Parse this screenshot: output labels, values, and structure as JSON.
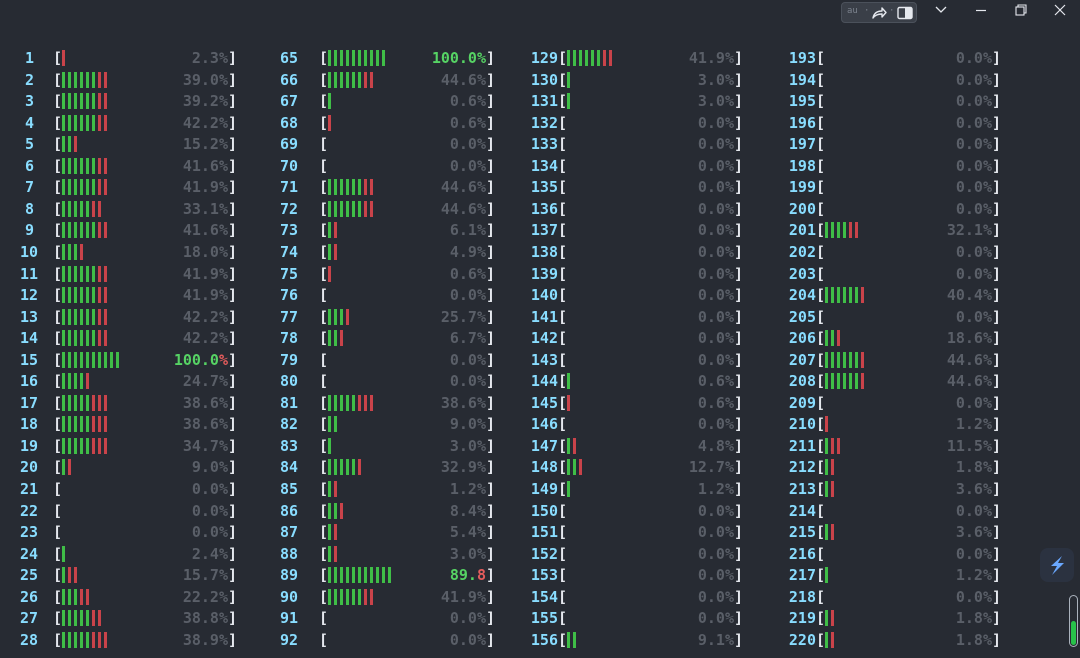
{
  "titlebar": {
    "mini_label": "au",
    "icons": [
      "chevron-down-icon",
      "minimize-icon",
      "restore-icon",
      "close-icon",
      "share-icon",
      "split-view-icon"
    ]
  },
  "columns": [
    [
      {
        "n": "1",
        "g": 0,
        "r": 1,
        "p": "2.3%"
      },
      {
        "n": "2",
        "g": 6,
        "r": 2,
        "p": "39.0%"
      },
      {
        "n": "3",
        "g": 6,
        "r": 2,
        "p": "39.2%"
      },
      {
        "n": "4",
        "g": 6,
        "r": 2,
        "p": "42.2%"
      },
      {
        "n": "5",
        "g": 2,
        "r": 1,
        "p": "15.2%"
      },
      {
        "n": "6",
        "g": 6,
        "r": 2,
        "p": "41.6%"
      },
      {
        "n": "7",
        "g": 6,
        "r": 2,
        "p": "41.9%"
      },
      {
        "n": "8",
        "g": 5,
        "r": 2,
        "p": "33.1%"
      },
      {
        "n": "9",
        "g": 6,
        "r": 2,
        "p": "41.6%"
      },
      {
        "n": "10",
        "g": 3,
        "r": 1,
        "p": "18.0%"
      },
      {
        "n": "11",
        "g": 6,
        "r": 2,
        "p": "41.9%"
      },
      {
        "n": "12",
        "g": 6,
        "r": 2,
        "p": "41.9%"
      },
      {
        "n": "13",
        "g": 6,
        "r": 2,
        "p": "42.2%"
      },
      {
        "n": "14",
        "g": 6,
        "r": 2,
        "p": "42.2%"
      },
      {
        "n": "15",
        "g": 10,
        "r": 0,
        "p": "100.0",
        "p2": "%",
        "hot": true
      },
      {
        "n": "16",
        "g": 4,
        "r": 1,
        "p": "24.7%"
      },
      {
        "n": "17",
        "g": 5,
        "r": 3,
        "p": "38.6%"
      },
      {
        "n": "18",
        "g": 5,
        "r": 3,
        "p": "38.6%"
      },
      {
        "n": "19",
        "g": 5,
        "r": 3,
        "p": "34.7%"
      },
      {
        "n": "20",
        "g": 1,
        "r": 1,
        "p": "9.0%"
      },
      {
        "n": "21",
        "g": 0,
        "r": 0,
        "p": "0.0%"
      },
      {
        "n": "22",
        "g": 0,
        "r": 0,
        "p": "0.0%"
      },
      {
        "n": "23",
        "g": 0,
        "r": 0,
        "p": "0.0%"
      },
      {
        "n": "24",
        "g": 1,
        "r": 0,
        "p": "2.4%"
      },
      {
        "n": "25",
        "g": 1,
        "r": 2,
        "p": "15.7%"
      },
      {
        "n": "26",
        "g": 3,
        "r": 2,
        "p": "22.2%"
      },
      {
        "n": "27",
        "g": 5,
        "r": 2,
        "p": "38.8%"
      },
      {
        "n": "28",
        "g": 5,
        "r": 3,
        "p": "38.9%"
      }
    ],
    [
      {
        "n": "65",
        "g": 10,
        "r": 0,
        "p": "100.0%",
        "hot": true
      },
      {
        "n": "66",
        "g": 6,
        "r": 2,
        "p": "44.6%"
      },
      {
        "n": "67",
        "g": 1,
        "r": 0,
        "p": "0.6%"
      },
      {
        "n": "68",
        "g": 0,
        "r": 1,
        "p": "0.6%"
      },
      {
        "n": "69",
        "g": 0,
        "r": 0,
        "p": "0.0%"
      },
      {
        "n": "70",
        "g": 0,
        "r": 0,
        "p": "0.0%"
      },
      {
        "n": "71",
        "g": 6,
        "r": 2,
        "p": "44.6%"
      },
      {
        "n": "72",
        "g": 6,
        "r": 2,
        "p": "44.6%"
      },
      {
        "n": "73",
        "g": 1,
        "r": 1,
        "p": "6.1%"
      },
      {
        "n": "74",
        "g": 1,
        "r": 1,
        "p": "4.9%"
      },
      {
        "n": "75",
        "g": 0,
        "r": 1,
        "p": "0.6%"
      },
      {
        "n": "76",
        "g": 0,
        "r": 0,
        "p": "0.0%"
      },
      {
        "n": "77",
        "g": 3,
        "r": 1,
        "p": "25.7%"
      },
      {
        "n": "78",
        "g": 2,
        "r": 1,
        "p": "6.7%"
      },
      {
        "n": "79",
        "g": 0,
        "r": 0,
        "p": "0.0%"
      },
      {
        "n": "80",
        "g": 0,
        "r": 0,
        "p": "0.0%"
      },
      {
        "n": "81",
        "g": 5,
        "r": 3,
        "p": "38.6%"
      },
      {
        "n": "82",
        "g": 2,
        "r": 0,
        "p": "9.0%"
      },
      {
        "n": "83",
        "g": 1,
        "r": 0,
        "p": "3.0%"
      },
      {
        "n": "84",
        "g": 5,
        "r": 1,
        "p": "32.9%"
      },
      {
        "n": "85",
        "g": 1,
        "r": 1,
        "p": "1.2%"
      },
      {
        "n": "86",
        "g": 2,
        "r": 1,
        "p": "8.4%"
      },
      {
        "n": "87",
        "g": 1,
        "r": 1,
        "p": "5.4%"
      },
      {
        "n": "88",
        "g": 1,
        "r": 1,
        "p": "3.0%"
      },
      {
        "n": "89",
        "g": 11,
        "r": 0,
        "p": "89.",
        "p2": "8",
        "hot": true
      },
      {
        "n": "90",
        "g": 6,
        "r": 2,
        "p": "41.9%"
      },
      {
        "n": "91",
        "g": 0,
        "r": 0,
        "p": "0.0%"
      },
      {
        "n": "92",
        "g": 0,
        "r": 0,
        "p": "0.0%"
      }
    ],
    [
      {
        "n": "129",
        "g": 6,
        "r": 2,
        "p": "41.9%"
      },
      {
        "n": "130",
        "g": 1,
        "r": 0,
        "p": "3.0%"
      },
      {
        "n": "131",
        "g": 1,
        "r": 0,
        "p": "3.0%"
      },
      {
        "n": "132",
        "g": 0,
        "r": 0,
        "p": "0.0%"
      },
      {
        "n": "133",
        "g": 0,
        "r": 0,
        "p": "0.0%"
      },
      {
        "n": "134",
        "g": 0,
        "r": 0,
        "p": "0.0%"
      },
      {
        "n": "135",
        "g": 0,
        "r": 0,
        "p": "0.0%"
      },
      {
        "n": "136",
        "g": 0,
        "r": 0,
        "p": "0.0%"
      },
      {
        "n": "137",
        "g": 0,
        "r": 0,
        "p": "0.0%"
      },
      {
        "n": "138",
        "g": 0,
        "r": 0,
        "p": "0.0%"
      },
      {
        "n": "139",
        "g": 0,
        "r": 0,
        "p": "0.0%"
      },
      {
        "n": "140",
        "g": 0,
        "r": 0,
        "p": "0.0%"
      },
      {
        "n": "141",
        "g": 0,
        "r": 0,
        "p": "0.0%"
      },
      {
        "n": "142",
        "g": 0,
        "r": 0,
        "p": "0.0%"
      },
      {
        "n": "143",
        "g": 0,
        "r": 0,
        "p": "0.0%"
      },
      {
        "n": "144",
        "g": 1,
        "r": 0,
        "p": "0.6%"
      },
      {
        "n": "145",
        "g": 0,
        "r": 1,
        "p": "0.6%"
      },
      {
        "n": "146",
        "g": 0,
        "r": 0,
        "p": "0.0%"
      },
      {
        "n": "147",
        "g": 1,
        "r": 1,
        "p": "4.8%"
      },
      {
        "n": "148",
        "g": 2,
        "r": 1,
        "p": "12.7%"
      },
      {
        "n": "149",
        "g": 1,
        "r": 0,
        "p": "1.2%"
      },
      {
        "n": "150",
        "g": 0,
        "r": 0,
        "p": "0.0%"
      },
      {
        "n": "151",
        "g": 0,
        "r": 0,
        "p": "0.0%"
      },
      {
        "n": "152",
        "g": 0,
        "r": 0,
        "p": "0.0%"
      },
      {
        "n": "153",
        "g": 0,
        "r": 0,
        "p": "0.0%"
      },
      {
        "n": "154",
        "g": 0,
        "r": 0,
        "p": "0.0%"
      },
      {
        "n": "155",
        "g": 0,
        "r": 0,
        "p": "0.0%"
      },
      {
        "n": "156",
        "g": 2,
        "r": 0,
        "p": "9.1%"
      }
    ],
    [
      {
        "n": "193",
        "g": 0,
        "r": 0,
        "p": "0.0%"
      },
      {
        "n": "194",
        "g": 0,
        "r": 0,
        "p": "0.0%"
      },
      {
        "n": "195",
        "g": 0,
        "r": 0,
        "p": "0.0%"
      },
      {
        "n": "196",
        "g": 0,
        "r": 0,
        "p": "0.0%"
      },
      {
        "n": "197",
        "g": 0,
        "r": 0,
        "p": "0.0%"
      },
      {
        "n": "198",
        "g": 0,
        "r": 0,
        "p": "0.0%"
      },
      {
        "n": "199",
        "g": 0,
        "r": 0,
        "p": "0.0%"
      },
      {
        "n": "200",
        "g": 0,
        "r": 0,
        "p": "0.0%"
      },
      {
        "n": "201",
        "g": 4,
        "r": 2,
        "p": "32.1%"
      },
      {
        "n": "202",
        "g": 0,
        "r": 0,
        "p": "0.0%"
      },
      {
        "n": "203",
        "g": 0,
        "r": 0,
        "p": "0.0%"
      },
      {
        "n": "204",
        "g": 6,
        "r": 1,
        "p": "40.4%"
      },
      {
        "n": "205",
        "g": 0,
        "r": 0,
        "p": "0.0%"
      },
      {
        "n": "206",
        "g": 2,
        "r": 1,
        "p": "18.6%"
      },
      {
        "n": "207",
        "g": 6,
        "r": 1,
        "p": "44.6%"
      },
      {
        "n": "208",
        "g": 6,
        "r": 1,
        "p": "44.6%"
      },
      {
        "n": "209",
        "g": 0,
        "r": 0,
        "p": "0.0%"
      },
      {
        "n": "210",
        "g": 0,
        "r": 1,
        "p": "1.2%"
      },
      {
        "n": "211",
        "g": 1,
        "r": 2,
        "p": "11.5%"
      },
      {
        "n": "212",
        "g": 1,
        "r": 1,
        "p": "1.8%"
      },
      {
        "n": "213",
        "g": 1,
        "r": 1,
        "p": "3.6%"
      },
      {
        "n": "214",
        "g": 0,
        "r": 0,
        "p": "0.0%"
      },
      {
        "n": "215",
        "g": 1,
        "r": 1,
        "p": "3.6%"
      },
      {
        "n": "216",
        "g": 0,
        "r": 0,
        "p": "0.0%"
      },
      {
        "n": "217",
        "g": 1,
        "r": 0,
        "p": "1.2%"
      },
      {
        "n": "218",
        "g": 0,
        "r": 0,
        "p": "0.0%"
      },
      {
        "n": "219",
        "g": 1,
        "r": 1,
        "p": "1.8%"
      },
      {
        "n": "220",
        "g": 1,
        "r": 1,
        "p": "1.8%"
      }
    ]
  ],
  "scrollbar": {
    "level": 0.5
  }
}
